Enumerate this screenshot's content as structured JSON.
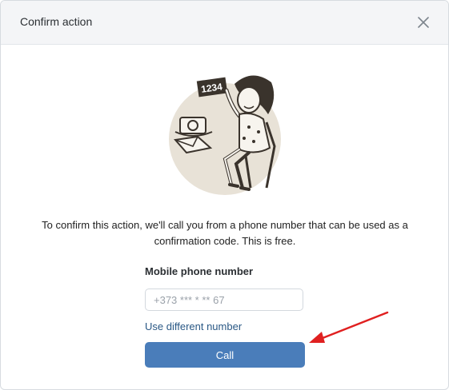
{
  "dialog": {
    "title": "Confirm action",
    "close_icon": "close-icon"
  },
  "illustration": {
    "card_text": "1234",
    "icon": "woman-phone-illustration"
  },
  "message": "To confirm this action, we'll call you from a phone number that can be used as a confirmation code. This is free.",
  "form": {
    "label": "Mobile phone number",
    "phone_placeholder": "+373 *** * ** 67",
    "alt_link": "Use different number",
    "call_label": "Call"
  },
  "colors": {
    "accent": "#4a7dba",
    "link": "#2a5885",
    "arrow": "#e02020"
  }
}
